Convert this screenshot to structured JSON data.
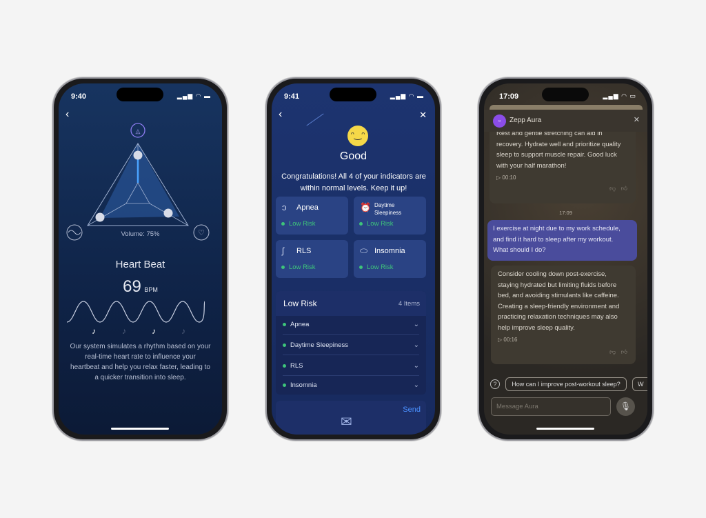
{
  "phone1": {
    "time": "9:40",
    "volume_label": "Volume: 75%",
    "volume_percent": 75,
    "title": "Heart Beat",
    "bpm_value": "69",
    "bpm_unit": "BPM",
    "description": "Our system simulates a rhythm based on your real-time heart rate to influence your heartbeat and help you relax faster, leading to a quicker transition into sleep.",
    "icons": [
      "back-icon",
      "shapes-icon",
      "sound-wave-icon",
      "heart-pulse-icon",
      "music-note-icon"
    ]
  },
  "phone2": {
    "time": "9:41",
    "status": "Good",
    "message": "Congratulations! All 4 of your indicators are within normal levels. Keep it up!",
    "cards": [
      {
        "name": "Apnea",
        "risk": "Low Risk",
        "icon": "ear-icon"
      },
      {
        "name": "Daytime Sleepiness",
        "risk": "Low Risk",
        "icon": "alarm-clock-icon"
      },
      {
        "name": "RLS",
        "risk": "Low Risk",
        "icon": "leg-icon"
      },
      {
        "name": "Insomnia",
        "risk": "Low Risk",
        "icon": "pill-icon"
      }
    ],
    "section_title": "Low Risk",
    "section_count": "4 Items",
    "section_items": [
      "Apnea",
      "Daytime Sleepiness",
      "RLS",
      "Insomnia"
    ],
    "send_label": "Send",
    "risk_color": "#3ec47a"
  },
  "phone3": {
    "time": "17:09",
    "app_name": "Zepp Aura",
    "msg1": "Rest and gentle stretching can aid in recovery. Hydrate well and prioritize quality sleep to support muscle repair. Good luck with your half marathon!",
    "msg1_duration": "00:10",
    "timestamp": "17:09",
    "user_msg": "I exercise at night due to my work schedule, and find it hard to sleep after my workout. What should I do?",
    "msg2": "Consider cooling down post-exercise, staying hydrated but limiting fluids before bed, and avoiding stimulants like caffeine. Creating a sleep-friendly environment and practicing relaxation techniques may also help improve sleep quality.",
    "msg2_duration": "00:16",
    "suggestion": "How can I improve post-workout sleep?",
    "suggestion2": "W",
    "input_placeholder": "Message Aura",
    "user_bubble_color": "#4a4c9c"
  }
}
